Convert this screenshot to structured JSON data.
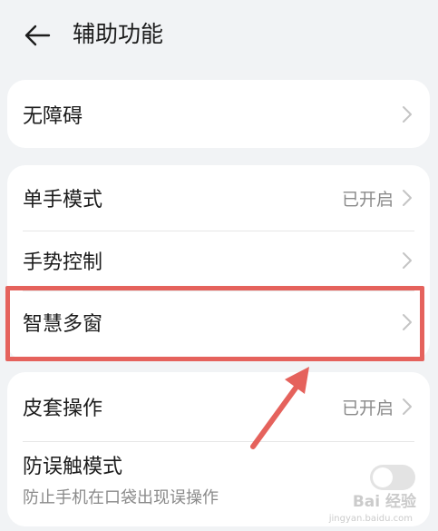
{
  "header": {
    "title": "辅助功能",
    "back_icon": "back-arrow-icon"
  },
  "accessibility_card": {
    "label": "无障碍"
  },
  "gesture_card": {
    "one_hand_mode": {
      "label": "单手模式",
      "value": "已开启"
    },
    "gesture_control": {
      "label": "手势控制"
    },
    "smart_multiwindow": {
      "label": "智慧多窗"
    }
  },
  "cover_card": {
    "cover_operation": {
      "label": "皮套操作",
      "value": "已开启"
    },
    "accidental_touch": {
      "label": "防误触模式",
      "description": "防止手机在口袋出现误操作",
      "enabled": false
    }
  },
  "watermark": {
    "text": "Bai 经验",
    "sub": "jingyan.baidu.com"
  },
  "colors": {
    "highlight": "#e5625c",
    "background": "#f1f3f5"
  }
}
